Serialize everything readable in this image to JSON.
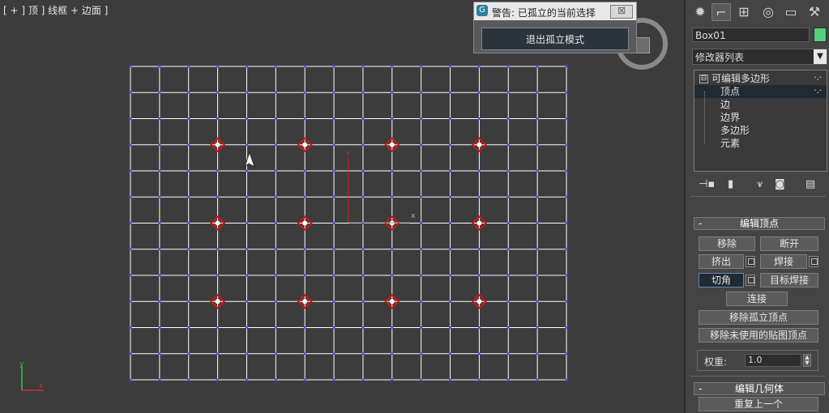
{
  "viewport": {
    "label": "[ + ] 顶 ] 线框 + 边面 ]",
    "grid_cols": 15,
    "grid_rows": 12,
    "selected_vertices": [
      [
        3,
        3
      ],
      [
        6,
        3
      ],
      [
        9,
        3
      ],
      [
        12,
        3
      ],
      [
        3,
        6
      ],
      [
        6,
        6
      ],
      [
        9,
        6
      ],
      [
        12,
        6
      ],
      [
        3,
        9
      ],
      [
        6,
        9
      ],
      [
        9,
        9
      ],
      [
        12,
        9
      ]
    ],
    "gizmo": {
      "y_label": "y",
      "x_label": "x"
    },
    "axis_tripod": {
      "y_label": "y",
      "x_label": "x"
    },
    "colors": {
      "grid_line": "#ffffff",
      "vertex": "#4d4dff",
      "selected": "#dd1111",
      "gizmo": "#cc2222"
    }
  },
  "warning": {
    "icon": "G",
    "title": "警告: 已孤立的当前选择",
    "close_label": "☒",
    "exit_button": "退出孤立模式"
  },
  "panel": {
    "tabs": [
      "create-icon",
      "modify-icon",
      "hierarchy-icon",
      "motion-icon",
      "display-icon",
      "utilities-icon"
    ],
    "object_name": "Box01",
    "object_color": "#4fd27e",
    "modifier_list": "修改器列表",
    "stack": {
      "root": "可编辑多边形",
      "root_expander": "⊟",
      "items": [
        "顶点",
        "边",
        "边界",
        "多边形",
        "元素"
      ],
      "selected": "顶点"
    },
    "edit_vertices": {
      "title": "编辑顶点",
      "collapse": "-",
      "remove": "移除",
      "break": "断开",
      "extrude": "挤出",
      "weld": "焊接",
      "chamfer": "切角",
      "target_weld": "目标焊接",
      "connect": "连接",
      "remove_isolated": "移除孤立顶点",
      "remove_unused": "移除未使用的贴图顶点",
      "weight_label": "权重:",
      "weight_value": "1.0"
    },
    "edit_geometry": {
      "title": "编辑几何体",
      "collapse": "-",
      "repeat_last": "重复上一个"
    }
  }
}
